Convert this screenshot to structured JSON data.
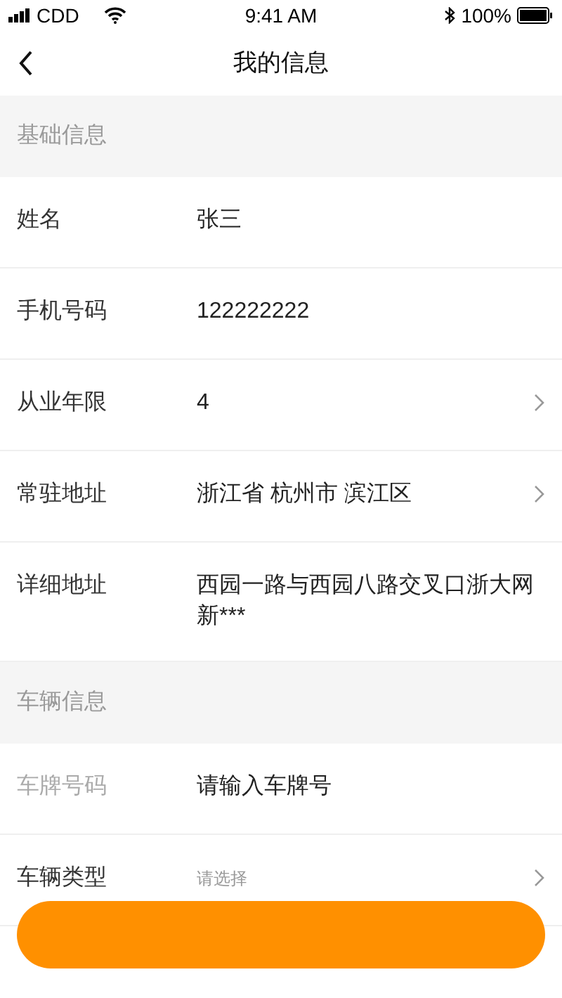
{
  "status_bar": {
    "carrier": "CDD",
    "time": "9:41 AM",
    "battery": "100%"
  },
  "nav": {
    "title": "我的信息"
  },
  "sections": [
    {
      "header": "基础信息",
      "rows": [
        {
          "label": "姓名",
          "value": "张三",
          "chevron": false,
          "kind": "value",
          "label_muted": false
        },
        {
          "label": "手机号码",
          "value": "122222222",
          "chevron": false,
          "kind": "value",
          "label_muted": false
        },
        {
          "label": "从业年限",
          "value": "4",
          "chevron": true,
          "kind": "value",
          "label_muted": false
        },
        {
          "label": "常驻地址",
          "value": "浙江省 杭州市 滨江区",
          "chevron": true,
          "kind": "value",
          "label_muted": false
        },
        {
          "label": "详细地址",
          "value": "西园一路与西园八路交叉口浙大网新***",
          "chevron": false,
          "kind": "value",
          "label_muted": false
        }
      ]
    },
    {
      "header": "车辆信息",
      "rows": [
        {
          "label": "车牌号码",
          "value": "请输入车牌号",
          "chevron": false,
          "kind": "value",
          "label_muted": true
        },
        {
          "label": "车辆类型",
          "value": "请选择",
          "chevron": true,
          "kind": "hint",
          "label_muted": false
        }
      ]
    }
  ],
  "bottom_button": {
    "color": "#ff9000"
  }
}
